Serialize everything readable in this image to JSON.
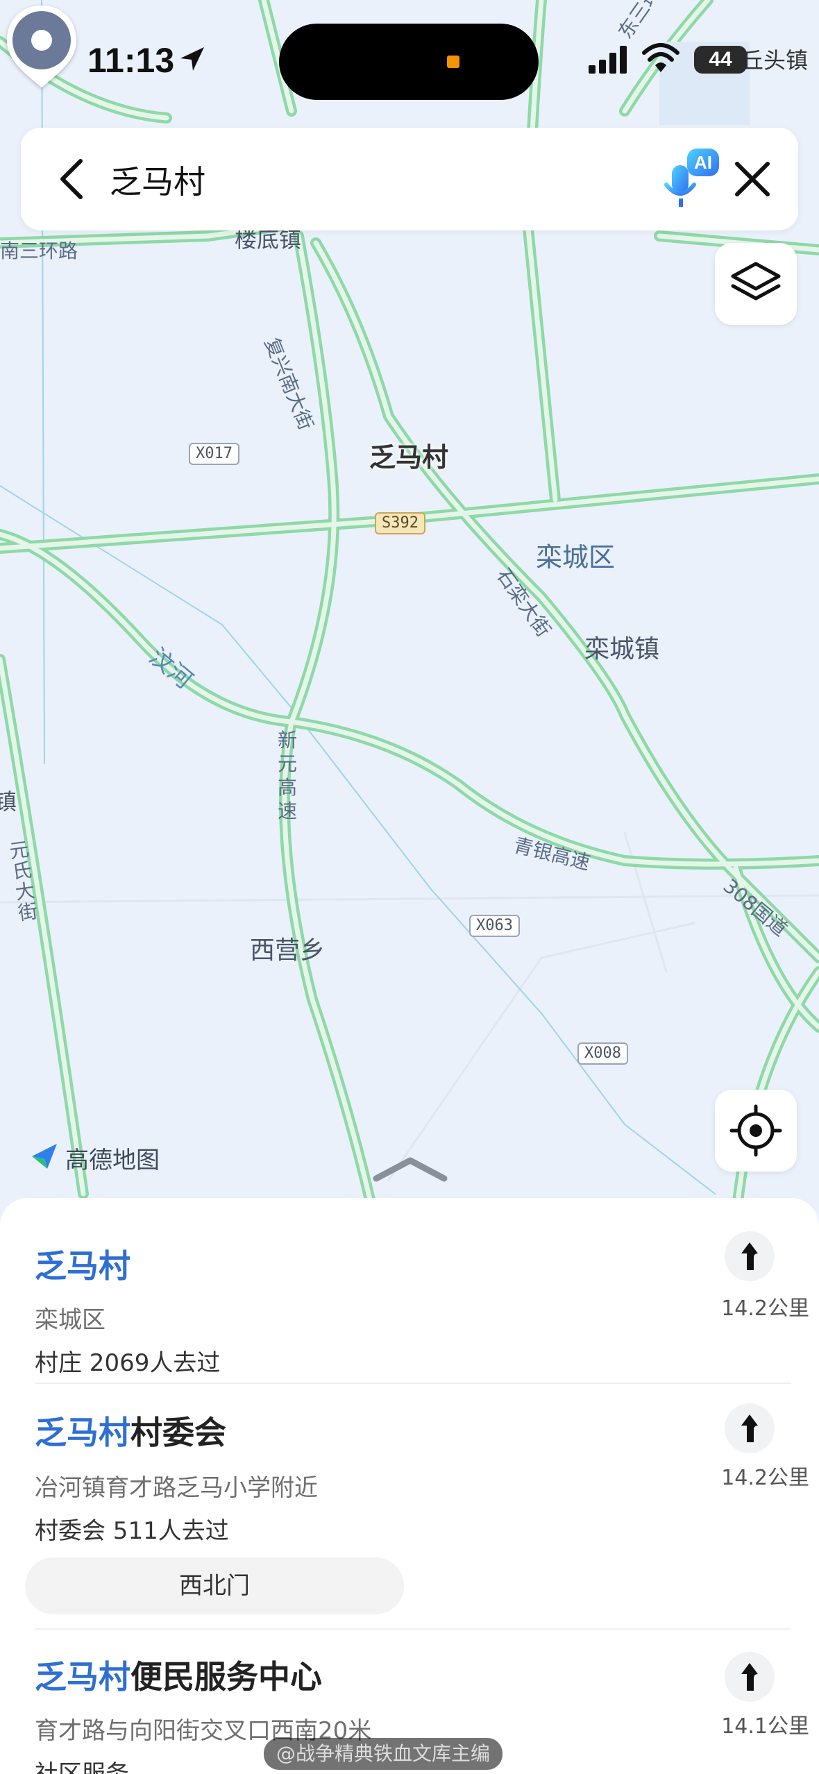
{
  "status_bar": {
    "time": "11:13",
    "battery": "44",
    "icons": [
      "location-arrow-icon",
      "signal-icon",
      "wifi-icon",
      "battery-icon"
    ]
  },
  "search": {
    "query": "乏马村",
    "icons": [
      "back-icon",
      "ai-voice-icon",
      "close-icon"
    ],
    "ai_badge": "AI"
  },
  "map": {
    "provider": "高德地图",
    "poi_label": "乏马村",
    "places": {
      "loudizhen": "楼底镇",
      "luancheng_district": "栾城区",
      "luancheng_town": "栾城镇",
      "xiyingxiang": "西营乡",
      "qiutou": "丘头镇",
      "jiao": "镇"
    },
    "roads": {
      "south_ring": "南三环路",
      "east_ring": "东三环路",
      "fuxing": "复兴南大街",
      "shiluan": "石栾大街",
      "xinyuan": "新元高速",
      "qingyin": "青银高速",
      "g308": "308国道",
      "yuanshi": "元氏大街"
    },
    "river": "汶河",
    "shields": {
      "x017": "X017",
      "s392": "S392",
      "x063": "X063",
      "x008": "X008"
    }
  },
  "results": [
    {
      "title_highlight": "乏马村",
      "title_rest": "",
      "address": "栾城区",
      "meta": "村庄  2069人去过",
      "distance": "14.2公里"
    },
    {
      "title_highlight": "乏马村",
      "title_rest": "村委会",
      "address": "冶河镇育才路乏马小学附近",
      "meta": "村委会  511人去过",
      "distance": "14.2公里",
      "chip": "西北门"
    },
    {
      "title_highlight": "乏马村",
      "title_rest": "便民服务中心",
      "address": "育才路与向阳街交叉口西南20米",
      "meta": "社区服务",
      "distance": "14.1公里"
    }
  ],
  "watermark": "@战争精典铁血文库主编",
  "colors": {
    "highlight": "#2d6fd3",
    "road_green": "#9fe0b4",
    "map_bg": "#eaf1fb",
    "pin": "#6b7a99"
  }
}
